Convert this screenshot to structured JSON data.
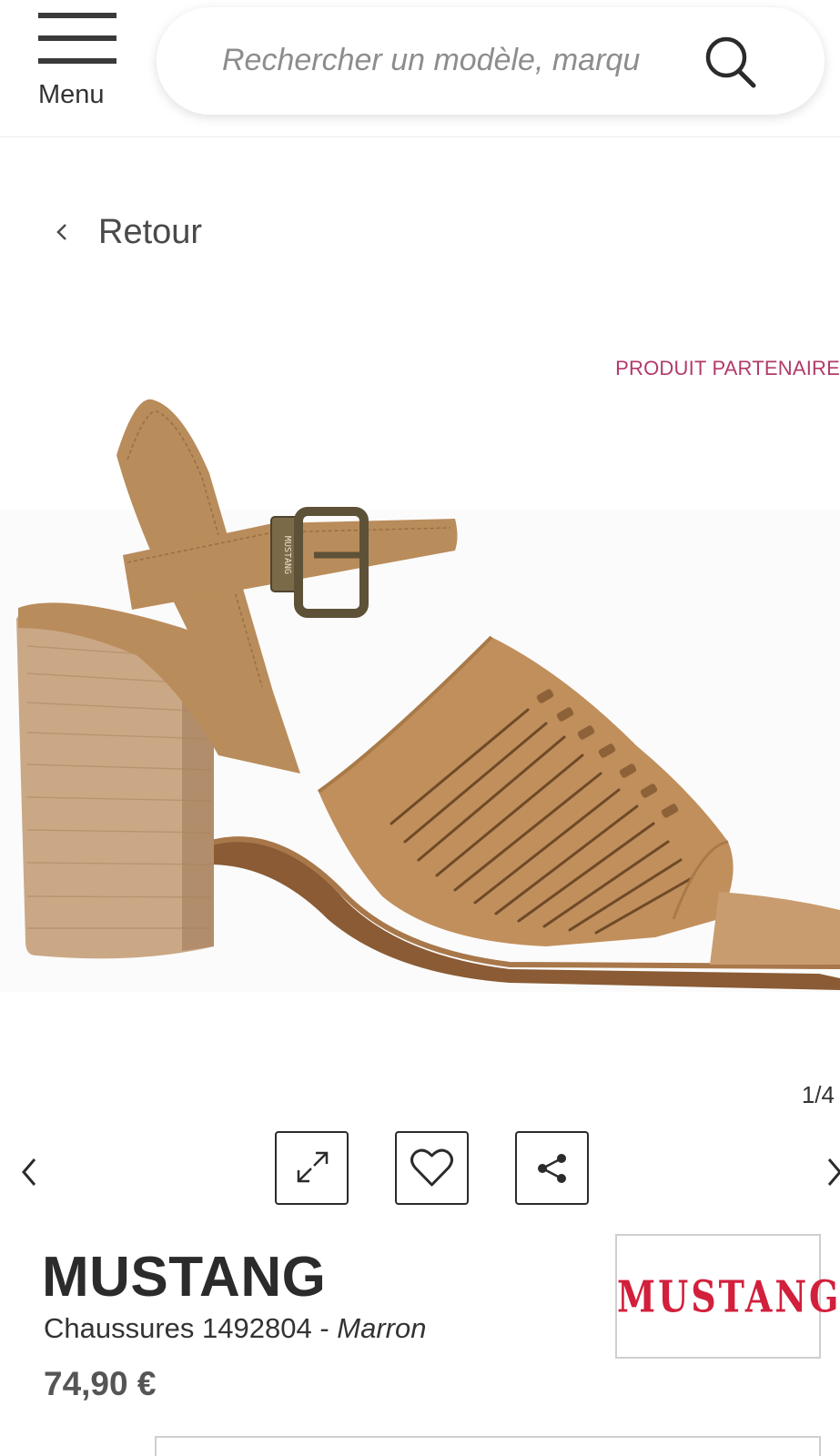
{
  "header": {
    "menu_label": "Menu",
    "search_placeholder": "Rechercher un modèle, marqu"
  },
  "back_label": "Retour",
  "partner_label": "PRODUIT PARTENAIRE",
  "gallery": {
    "counter": "1/4",
    "image_alt": "Sandale à talon MUSTANG marron"
  },
  "product": {
    "brand": "MUSTANG",
    "category": "Chaussures 1492804",
    "separator": " - ",
    "color": "Marron",
    "price": "74,90 €",
    "brand_logo": "MUSTANG",
    "buckle_text": "MUSTANG"
  },
  "colors": {
    "accent": "#b23a6b",
    "brand_logo": "#d21f3c",
    "text": "#2b2b2b",
    "price": "#555555"
  },
  "icons": [
    "menu-icon",
    "search-icon",
    "chevron-left-icon",
    "expand-icon",
    "heart-icon",
    "share-icon",
    "chevron-right-icon"
  ]
}
